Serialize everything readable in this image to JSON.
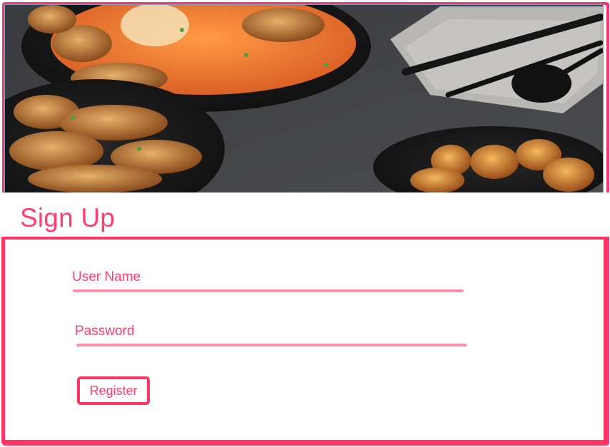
{
  "page": {
    "accent_color": "#ff3566",
    "text_color": "#ff3f6f",
    "underline_color": "#ff8fa8"
  },
  "hero": {
    "image_icon": "food-photo-icon"
  },
  "form": {
    "title": "Sign Up",
    "username_label": "User Name",
    "password_label": "Password",
    "register_label": "Register"
  }
}
